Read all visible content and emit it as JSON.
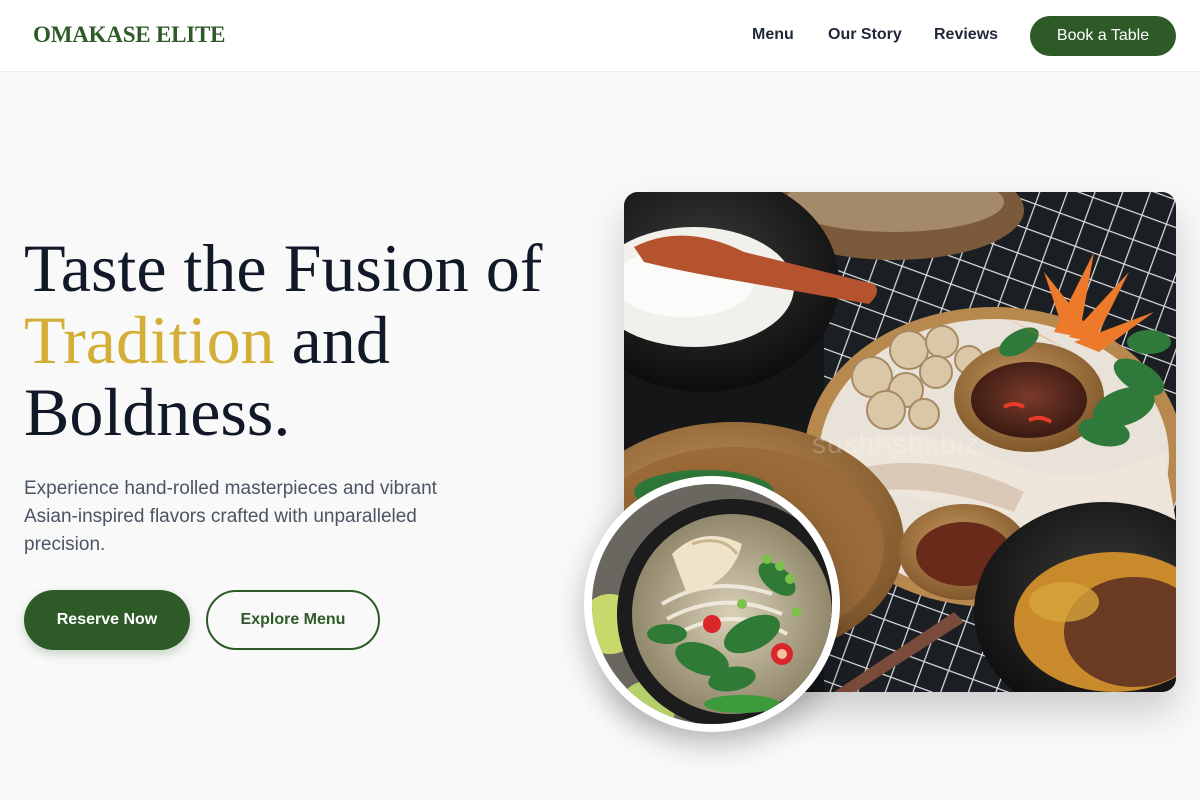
{
  "brand": {
    "name": "OMAKASE ELITE",
    "color": "#2d5a27",
    "accent": "#d4af37"
  },
  "nav": {
    "links": [
      "Menu",
      "Our Story",
      "Reviews"
    ],
    "cta": "Book a Table"
  },
  "hero": {
    "headline_part1": "Taste the Fusion of",
    "headline_accent": "Tradition",
    "headline_part2": "and",
    "headline_part3": "Boldness.",
    "subtext": "Experience hand-rolled masterpieces and vibrant Asian-inspired flavors crafted with unparalleled precision.",
    "primary_button": "Reserve Now",
    "secondary_button": "Explore Menu"
  },
  "images": {
    "main_alt": "Asian feast spread with rice, dipping sauce, mushrooms and garnishes",
    "main_watermark": "sushi-shi.biz",
    "circle_alt": "Bowl of pho with herbs, chili and lime"
  }
}
